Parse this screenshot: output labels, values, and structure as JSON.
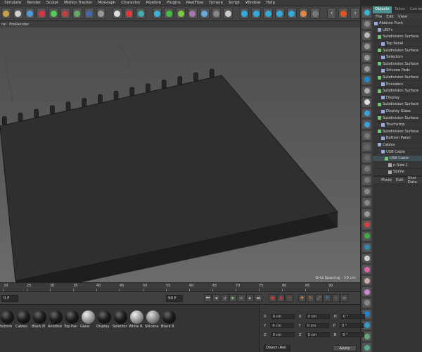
{
  "menu": {
    "items": [
      "Simulate",
      "Render",
      "Sculpt",
      "Motion Tracker",
      "MoGraph",
      "Character",
      "Pipeline",
      "Plugins",
      "RealFlow",
      "Octane",
      "Script",
      "Window",
      "Help"
    ]
  },
  "viewport": {
    "header_items": [
      "rel",
      "ProRender"
    ],
    "grid_spacing": "Grid Spacing : 10 cm"
  },
  "objects_panel": {
    "tabs": [
      "Objects",
      "Takes",
      "Content B"
    ],
    "menu": [
      "File",
      "Edit",
      "View"
    ],
    "tree": [
      {
        "label": "Ableton Push",
        "color": "#9ad",
        "indent": 0
      },
      {
        "label": "LED's",
        "color": "#9ad",
        "indent": 1
      },
      {
        "label": "Subdivision Surface",
        "color": "#6c6",
        "indent": 1
      },
      {
        "label": "Top Panel",
        "color": "#9ad",
        "indent": 2
      },
      {
        "label": "Subdivision Surface",
        "color": "#6c6",
        "indent": 1
      },
      {
        "label": "Selectors",
        "color": "#9ad",
        "indent": 2
      },
      {
        "label": "Subdivision Surface",
        "color": "#6c6",
        "indent": 1
      },
      {
        "label": "Silicone Pads",
        "color": "#9ad",
        "indent": 2
      },
      {
        "label": "Subdivision Surface",
        "color": "#6c6",
        "indent": 1
      },
      {
        "label": "Encoders",
        "color": "#9ad",
        "indent": 2
      },
      {
        "label": "Subdivision Surface",
        "color": "#6c6",
        "indent": 1
      },
      {
        "label": "Display",
        "color": "#9ad",
        "indent": 2
      },
      {
        "label": "Subdivision Surface",
        "color": "#6c6",
        "indent": 1
      },
      {
        "label": "Display Glass",
        "color": "#9ad",
        "indent": 2
      },
      {
        "label": "Subdivision Surface",
        "color": "#6c6",
        "indent": 1
      },
      {
        "label": "Touchstrip",
        "color": "#9ad",
        "indent": 2
      },
      {
        "label": "Subdivision Surface",
        "color": "#6c6",
        "indent": 1
      },
      {
        "label": "Bottom Panel",
        "color": "#9ad",
        "indent": 2
      },
      {
        "label": "Cables",
        "color": "#9ad",
        "indent": 1
      },
      {
        "label": "USB Cable",
        "color": "#9ad",
        "indent": 2
      },
      {
        "label": "USB Cable",
        "color": "#6c6",
        "indent": 3
      },
      {
        "label": "n-Side.1",
        "color": "#aaa",
        "indent": 4
      },
      {
        "label": "Spline",
        "color": "#aaa",
        "indent": 4
      }
    ]
  },
  "attributes": {
    "menu": [
      "Mode",
      "Edit",
      "User Data"
    ]
  },
  "timeline": {
    "ticks": [
      "20",
      "25",
      "30",
      "35",
      "40",
      "45",
      "50",
      "55",
      "60",
      "65",
      "70",
      "75",
      "80",
      "85",
      "90"
    ],
    "frame_field": "0 F",
    "end_field": "90 F"
  },
  "materials": [
    {
      "label": "Bottom"
    },
    {
      "label": "Cables"
    },
    {
      "label": "Black Pl"
    },
    {
      "label": "Anodize"
    },
    {
      "label": "Top Pan"
    },
    {
      "label": "Glass"
    },
    {
      "label": "Display"
    },
    {
      "label": "Selector"
    },
    {
      "label": "White R"
    },
    {
      "label": "Silicone"
    },
    {
      "label": "Black R"
    }
  ],
  "coordinates": {
    "rows": [
      {
        "a": "X",
        "av": "0 cm",
        "b": "X",
        "bv": "0 cm",
        "c": "H",
        "cv": "0 °"
      },
      {
        "a": "Y",
        "av": "0 cm",
        "b": "Y",
        "bv": "0 cm",
        "c": "P",
        "cv": "0 °"
      },
      {
        "a": "Z",
        "av": "0 cm",
        "b": "Z",
        "bv": "0 cm",
        "c": "B",
        "cv": "0 °"
      }
    ],
    "mode": "Object (Rel)",
    "apply_label": "Apply"
  }
}
